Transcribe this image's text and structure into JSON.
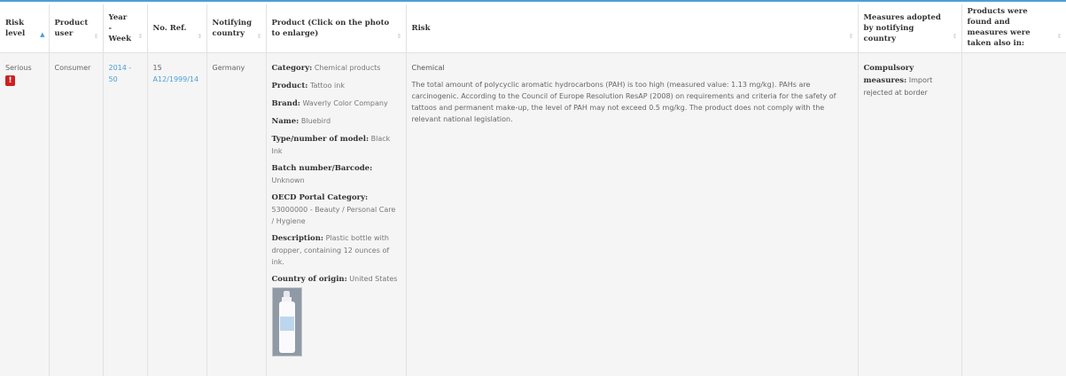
{
  "headers": {
    "risk_level": "Risk level",
    "product_user": "Product user",
    "year_week": "Year - Week",
    "no_ref": "No. Ref.",
    "notifying_country": "Notifying country",
    "product": "Product (Click on the photo to enlarge)",
    "risk": "Risk",
    "measures": "Measures adopted by notifying country",
    "products_found": "Products were found and measures were taken also in:"
  },
  "sort_icons": {
    "active": "▲",
    "inactive": "⇕"
  },
  "row": {
    "risk_level": "Serious",
    "risk_icon": "!",
    "product_user": "Consumer",
    "year_week": "2014 - 50",
    "no_ref_num": "15",
    "no_ref_link": "A12/1999/14",
    "notifying_country": "Germany",
    "product": {
      "category_label": "Category:",
      "category": "Chemical products",
      "product_label": "Product:",
      "product": "Tattoo ink",
      "brand_label": "Brand:",
      "brand": "Waverly Color Company",
      "name_label": "Name:",
      "name": "Bluebird",
      "type_label": "Type/number of model:",
      "type": "Black Ink",
      "batch_label": "Batch number/Barcode:",
      "batch": "Unknown",
      "oecd_label": "OECD Portal Category:",
      "oecd": "53000000 - Beauty / Personal Care / Hygiene",
      "description_label": "Description:",
      "description": "Plastic bottle with dropper, containing 12 ounces of ink.",
      "origin_label": "Country of origin:",
      "origin": "United States"
    },
    "risk_type": "Chemical",
    "risk_text": "The total amount of polycyclic aromatic hydrocarbons (PAH) is too high (measured value: 1.13 mg/kg). PAHs are carcinogenic. According to the Council of Europe Resolution ResAP (2008) on requirements and criteria for the safety of tattoos and permanent make-up, the level of PAH may not exceed 0.5 mg/kg. The product does not comply with the relevant national legislation.",
    "measures_label": "Compulsory measures:",
    "measures": "Import rejected at border",
    "products_found": ""
  }
}
